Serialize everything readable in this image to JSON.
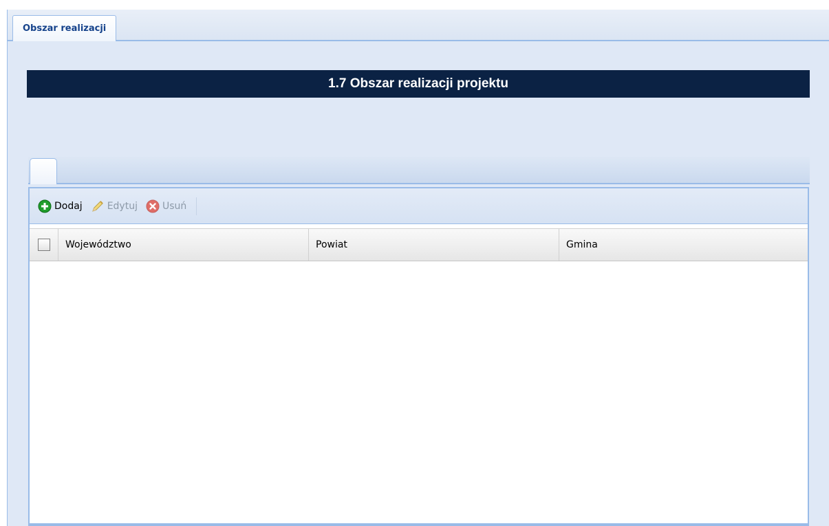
{
  "top_tabs": [
    {
      "label": "Obszar realizacji"
    }
  ],
  "section_title": "1.7 Obszar realizacji projektu",
  "toolbar": {
    "add_label": "Dodaj",
    "edit_label": "Edytuj",
    "delete_label": "Usuń"
  },
  "grid": {
    "columns": [
      "Województwo",
      "Powiat",
      "Gmina"
    ],
    "rows": []
  },
  "colors": {
    "title_bar_bg": "#0b2244",
    "panel_bg": "#dfe8f6",
    "border": "#99bbe8",
    "add_icon": "#1f9d2b",
    "delete_icon": "#e0584f"
  },
  "icons": {
    "add": "plus-circle-icon",
    "edit": "pencil-icon",
    "delete": "x-circle-icon"
  }
}
